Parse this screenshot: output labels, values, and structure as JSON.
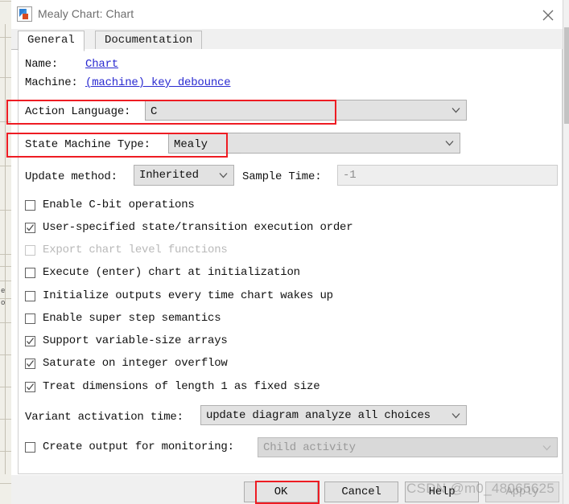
{
  "window": {
    "title": "Mealy Chart: Chart",
    "icon": "stateflow-chart-icon",
    "close_label": "close-icon"
  },
  "tabs": [
    {
      "label": "General",
      "active": true
    },
    {
      "label": "Documentation",
      "active": false
    }
  ],
  "fields": {
    "name_label": "Name:",
    "name_value": "Chart",
    "machine_label": "Machine:",
    "machine_value": "(machine) key debounce",
    "action_language_label": "Action Language:",
    "action_language_value": "C",
    "state_machine_type_label": "State Machine Type:",
    "state_machine_type_value": "Mealy",
    "update_method_label": "Update method:",
    "update_method_value": "Inherited",
    "sample_time_label": "Sample Time:",
    "sample_time_value": "-1",
    "variant_activation_label": "Variant activation time:",
    "variant_activation_value": "update diagram analyze all choices",
    "create_output_label": "Create output for monitoring:",
    "create_output_value": "Child activity"
  },
  "checkboxes": [
    {
      "label": "Enable C-bit operations",
      "checked": false,
      "disabled": false
    },
    {
      "label": "User-specified state/transition execution order",
      "checked": true,
      "disabled": false
    },
    {
      "label": "Export chart level functions",
      "checked": false,
      "disabled": true
    },
    {
      "label": "Execute (enter) chart at initialization",
      "checked": false,
      "disabled": false
    },
    {
      "label": "Initialize outputs every time chart wakes up",
      "checked": false,
      "disabled": false
    },
    {
      "label": "Enable super step semantics",
      "checked": false,
      "disabled": false
    },
    {
      "label": "Support variable-size arrays",
      "checked": true,
      "disabled": false
    },
    {
      "label": "Saturate on integer overflow",
      "checked": true,
      "disabled": false
    },
    {
      "label": "Treat dimensions of length 1 as fixed size",
      "checked": true,
      "disabled": false
    }
  ],
  "buttons": {
    "ok": "OK",
    "cancel": "Cancel",
    "help": "Help",
    "apply": "Apply"
  },
  "watermark": "CSDN @m0_48065625",
  "annotations": {
    "highlight_color": "#ee1c23",
    "highlighted": [
      "Action Language:",
      "State Machine Type:",
      "OK"
    ]
  }
}
